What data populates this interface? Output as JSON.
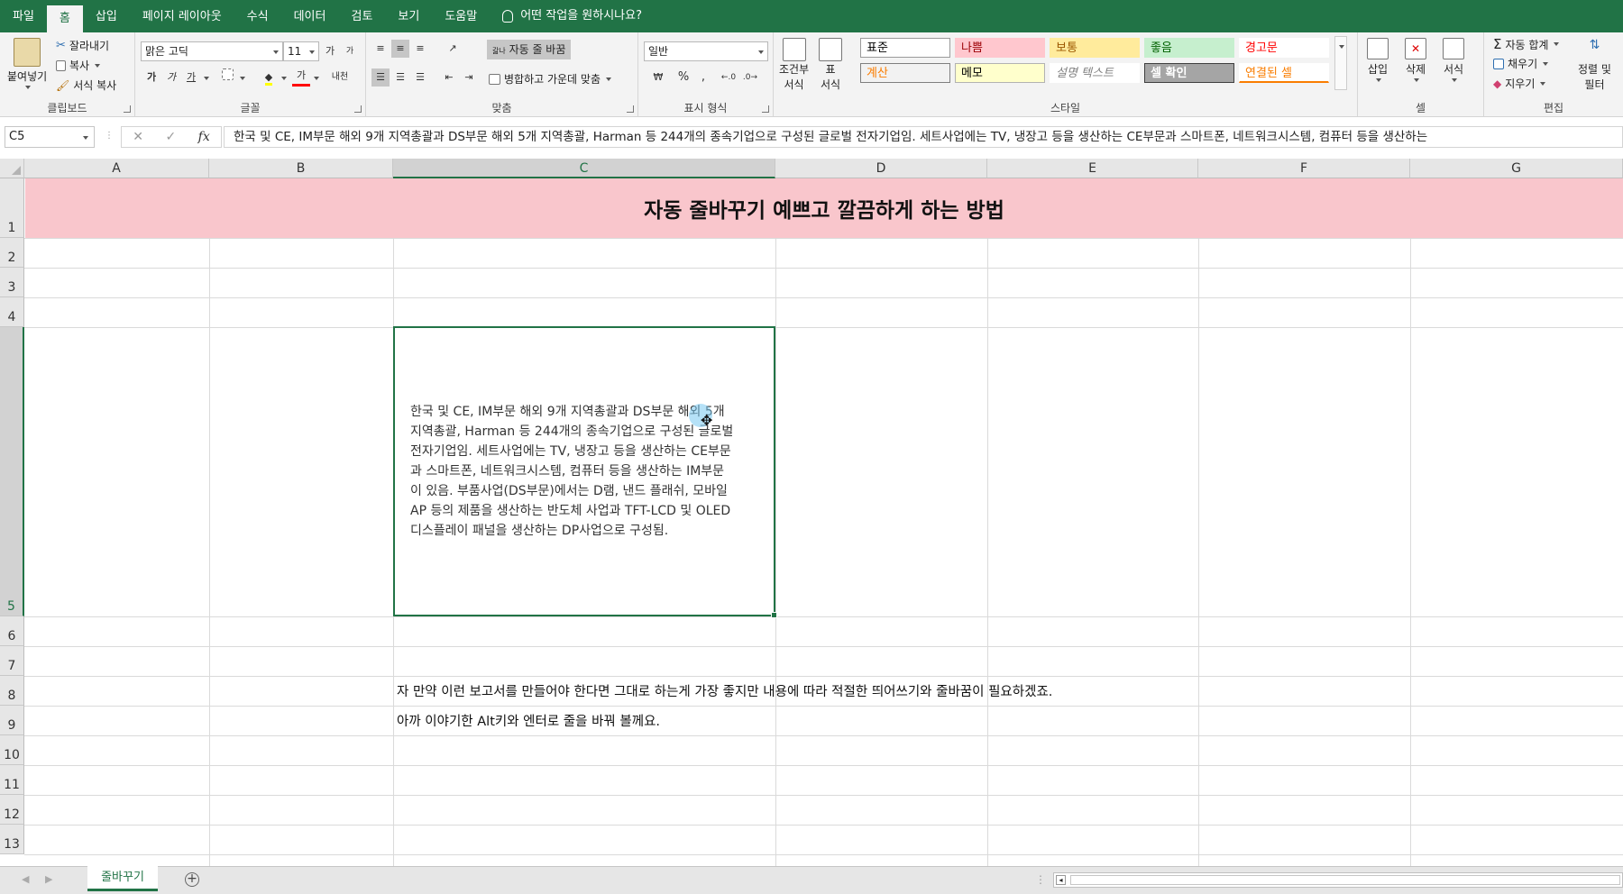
{
  "tabs": [
    "파일",
    "홈",
    "삽입",
    "페이지 레이아웃",
    "수식",
    "데이터",
    "검토",
    "보기",
    "도움말"
  ],
  "tell_me": "어떤 작업을 원하시나요?",
  "ribbon": {
    "clipboard": {
      "paste": "붙여넣기",
      "cut": "잘라내기",
      "copy": "복사",
      "format_painter": "서식 복사",
      "label": "클립보드"
    },
    "font": {
      "name": "맑은 고딕",
      "size": "11",
      "grow": "가",
      "shrink": "가",
      "bold": "가",
      "italic": "가",
      "underline": "가",
      "font_color": "가",
      "phonetic": "내천",
      "label": "글꼴"
    },
    "alignment": {
      "wrap_text": "자동 줄 바꿈",
      "wrap_icon": "갋나",
      "merge_center": "병합하고 가운데 맞춤",
      "label": "맞춤"
    },
    "number": {
      "format": "일반",
      "percent": "%",
      "comma": ",",
      "label": "표시 형식"
    },
    "styles": {
      "conditional": [
        "조건부",
        "서식"
      ],
      "table": [
        "표",
        "서식"
      ],
      "cells": [
        {
          "text": "표준",
          "bg": "#ffffff",
          "fg": "#000000",
          "border": "#9a9a9a"
        },
        {
          "text": "나쁨",
          "bg": "#ffc7ce",
          "fg": "#9c0006",
          "border": "#ffc7ce"
        },
        {
          "text": "보통",
          "bg": "#ffeb9c",
          "fg": "#9c5700",
          "border": "#ffeb9c"
        },
        {
          "text": "좋음",
          "bg": "#c6efce",
          "fg": "#006100",
          "border": "#c6efce"
        },
        {
          "text": "경고문",
          "bg": "#ffffff",
          "fg": "#ff0000",
          "border": "#ffffff"
        },
        {
          "text": "계산",
          "bg": "#f2f2f2",
          "fg": "#fa7d00",
          "border": "#7f7f7f"
        },
        {
          "text": "메모",
          "bg": "#ffffcc",
          "fg": "#000000",
          "border": "#b2b2b2"
        },
        {
          "text": "설명 텍스트",
          "bg": "#ffffff",
          "fg": "#7f7f7f",
          "border": "#ffffff"
        },
        {
          "text": "셀 확인",
          "bg": "#a5a5a5",
          "fg": "#ffffff",
          "border": "#3f3f3f"
        },
        {
          "text": "연결된 셀",
          "bg": "#ffffff",
          "fg": "#fa7d00",
          "border": "#ffffff"
        }
      ],
      "label": "스타일"
    },
    "cells": {
      "insert": "삽입",
      "delete": "삭제",
      "format": "서식",
      "label": "셀"
    },
    "editing": {
      "autosum": "자동 합계",
      "fill": "채우기",
      "clear": "지우기",
      "sort_filter": [
        "정렬 및",
        "필터"
      ],
      "label": "편집"
    }
  },
  "formula_bar": {
    "name_box": "C5",
    "cancel": "✕",
    "enter": "✓",
    "fx": "fx",
    "content": "한국 및 CE, IM부문 해외 9개 지역총괄과 DS부문 해외 5개 지역총괄, Harman 등 244개의 종속기업으로 구성된 글로벌 전자기업임. 세트사업에는 TV, 냉장고 등을 생산하는 CE부문과 스마트폰, 네트워크시스템, 컴퓨터 등을 생산하는"
  },
  "grid": {
    "columns": [
      "A",
      "B",
      "C",
      "D",
      "E",
      "F",
      "G"
    ],
    "selected_column": "C",
    "rows": [
      "1",
      "2",
      "3",
      "4",
      "5",
      "6",
      "7",
      "8",
      "9",
      "10",
      "11",
      "12",
      "13"
    ],
    "selected_row": "5",
    "title": "자동 줄바꾸기 예쁘고 깔끔하게 하는 방법",
    "c5_lines": [
      "한국 및 CE, IM부문 해외 9개 지역총괄과 DS부문 해외 5개",
      "지역총괄, Harman 등 244개의 종속기업으로 구성된 글로벌",
      "전자기업임. 세트사업에는 TV, 냉장고 등을 생산하는 CE부문",
      "과 스마트폰, 네트워크시스템, 컴퓨터 등을 생산하는 IM부문",
      "이 있음. 부품사업(DS부문)에서는 D램, 낸드 플래쉬, 모바일",
      "AP 등의 제품을 생산하는 반도체 사업과 TFT-LCD 및 OLED",
      "디스플레이 패널을 생산하는 DP사업으로 구성됨."
    ],
    "c8": "자 만약 이런 보고서를 만들어야 한다면 그대로 하는게 가장 좋지만 내용에 따라 적절한 띄어쓰기와 줄바꿈이 필요하겠죠.",
    "c9": "아까 이야기한 Alt키와 엔터로 줄을 바꿔 볼께요."
  },
  "sheet": {
    "active_tab": "줄바꾸기",
    "add": "+"
  }
}
